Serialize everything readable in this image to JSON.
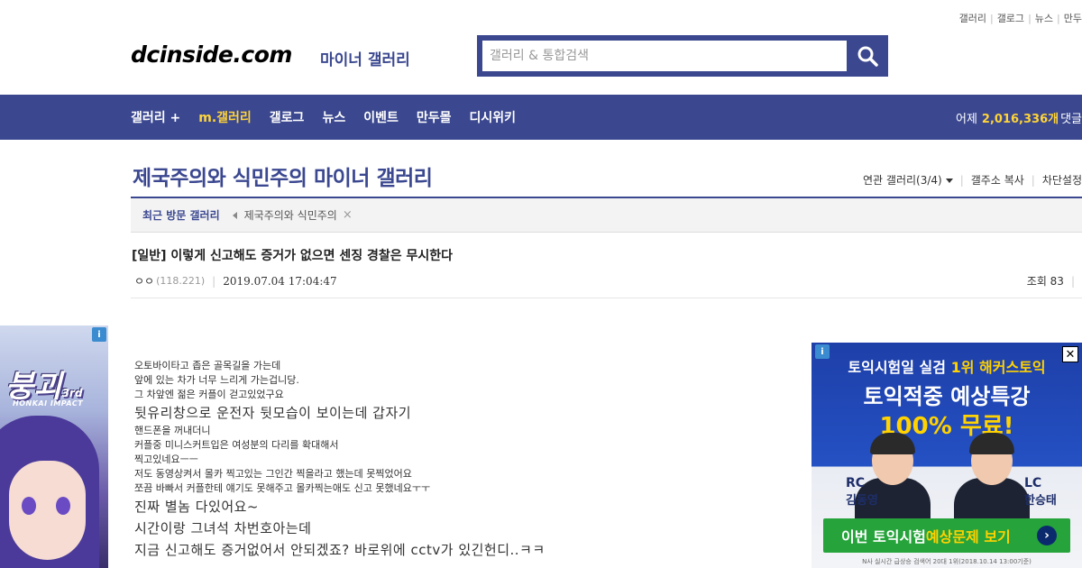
{
  "top_links": [
    "갤러리",
    "갤로그",
    "뉴스",
    "만두"
  ],
  "header": {
    "logo": "dcinside.com",
    "logo_sub": "마이너 갤러리",
    "search_placeholder": "갤러리 & 통합검색"
  },
  "nav": {
    "items": [
      "갤러리 +",
      "m.갤러리",
      "갤로그",
      "뉴스",
      "이벤트",
      "만두몰",
      "디시위키"
    ],
    "right_prefix": "어제",
    "right_count": "2,016,336개",
    "right_suffix": "댓글"
  },
  "gallery": {
    "title": "제국주의와 식민주의 마이너 갤러리",
    "tools": [
      "연관 갤러리(3/4)",
      "갤주소 복사",
      "차단설정"
    ]
  },
  "recent": {
    "label": "최근 방문 갤러리",
    "item": "제국주의와 식민주의",
    "close": "×"
  },
  "post": {
    "title": "[일반] 이렇게 신고해도 증거가 없으면 센징 경찰은 무시한다",
    "author": "ㅇㅇ",
    "ip": "(118.221)",
    "date": "2019.07.04 17:04:47",
    "views": "조회 83",
    "body": [
      {
        "size": "s",
        "text": "오토바이타고 좁은 골목길을 가는데"
      },
      {
        "size": "s",
        "text": "앞에 있는 차가  너무 느리게 가는겁니당."
      },
      {
        "size": "s",
        "text": "그 차앞엔 젊은 커플이 걷고있었구요"
      },
      {
        "size": "l",
        "text": "뒷유리창으로 운전자 뒷모습이 보이는데 갑자기"
      },
      {
        "size": "s",
        "text": "핸드폰을 꺼내더니"
      },
      {
        "size": "s",
        "text": "커플중 미니스커트입은 여성분의 다리를 확대해서"
      },
      {
        "size": "s",
        "text": "찍고있네요ㅡㅡ"
      },
      {
        "size": "s",
        "text": "저도 동영상켜서 몰카 찍고있는 그인간 찍을라고 했는데 못찍었어요"
      },
      {
        "size": "s",
        "text": "쪼끔 바빠서 커플한테 얘기도 못해주고 몰카찍는애도 신고 못했네요ㅜㅜ"
      },
      {
        "size": "l",
        "text": "진짜 별놈 다있어요~"
      },
      {
        "size": "l",
        "text": "시간이랑 그녀석 차번호아는데"
      },
      {
        "size": "l",
        "text": "지금 신고해도 증거없어서 안되겠죠? 바로위에 cctv가 있긴헌디..ㅋㅋ"
      }
    ]
  },
  "left_ad": {
    "badge": "i",
    "game_title": "붕괴",
    "game_num": "3rd",
    "game_sub": "HONKAI IMPACT"
  },
  "right_ad": {
    "badge": "i",
    "close": "✕",
    "line1_a": "토익시험일 실검 ",
    "line1_b": "1위 해커스토익",
    "line2": "토익적중 예상특강",
    "line3": "100% 무료!",
    "rc_code": "RC",
    "rc_name": "김동영",
    "lc_code": "LC",
    "lc_name": "한승태",
    "cta_a": "이번 토익시험 ",
    "cta_b": "예상문제 보기",
    "cta_arrow": "›",
    "footer": "N사 실시간 급상승 검색어 20대 1위(2018.10.14 13:00기준)"
  },
  "colors": {
    "brand": "#3b4890",
    "nav_highlight": "#ffd438"
  }
}
